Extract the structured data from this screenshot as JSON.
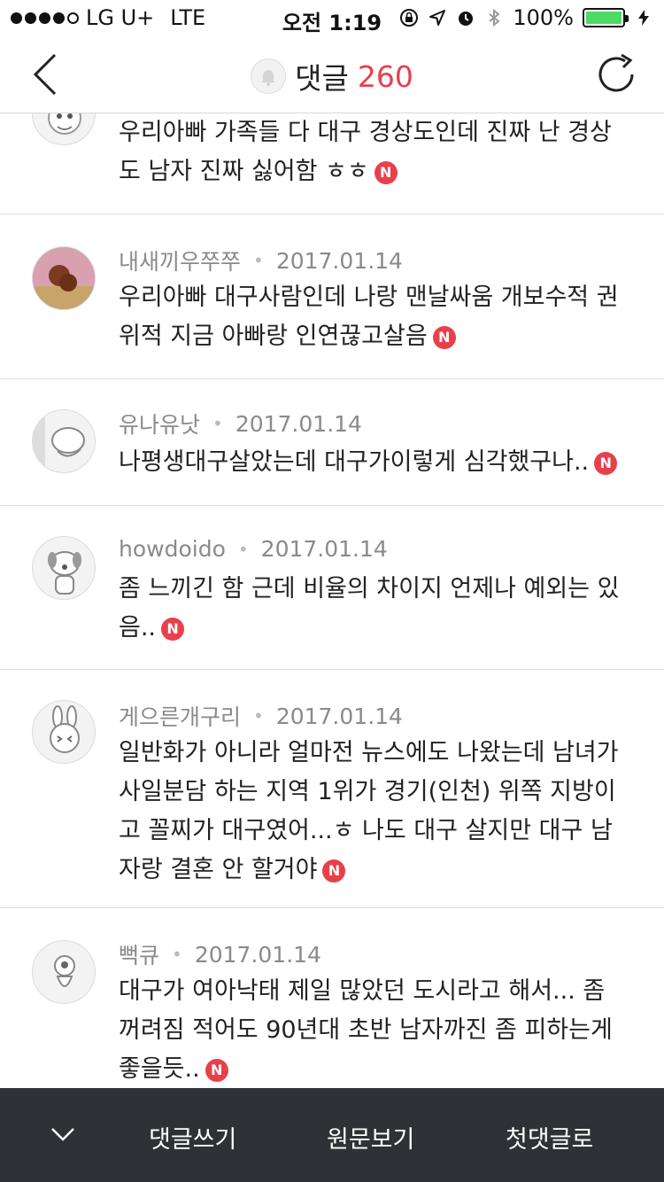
{
  "status_bar": {
    "carrier": "LG U+",
    "network": "LTE",
    "time": "오전 1:19",
    "battery": "100%",
    "signal_dots_filled": 4
  },
  "nav": {
    "title": "댓글",
    "count": "260"
  },
  "comments": [
    {
      "author": "",
      "date": "",
      "text": "우리아빠 가족들 다 대구 경상도인데 진짜 난 경상도 남자 진짜 싫어함 ㅎㅎ",
      "badge": "N",
      "avatar": "cartoon-character-icon"
    },
    {
      "author": "내새끼우쭈쭈",
      "date": "2017.01.14",
      "text": "우리아빠 대구사람인데 나랑 맨날싸움 개보수적 권위적 지금 아빠랑 인연끊고살음",
      "badge": "N",
      "avatar": "dog-photo-avatar"
    },
    {
      "author": "유나유낫",
      "date": "2017.01.14",
      "text": "나평생대구살았는데 대구가이렇게 심각했구나..",
      "badge": "N",
      "avatar": "cartoon-face-avatar"
    },
    {
      "author": "howdoido",
      "date": "2017.01.14",
      "text": "좀 느끼긴 함 근데 비율의 차이지 언제나 예외는 있음..",
      "badge": "N",
      "avatar": "cartoon-dog-avatar"
    },
    {
      "author": "게으른개구리",
      "date": "2017.01.14",
      "text": "일반화가 아니라 얼마전 뉴스에도 나왔는데 남녀가사일분담 하는 지역 1위가 경기(인천) 위쪽 지방이고 꼴찌가 대구였어...ㅎ 나도 대구 살지만 대구 남자랑 결혼 안 할거야",
      "badge": "N",
      "avatar": "cartoon-rabbit-avatar"
    },
    {
      "author": "뻑큐",
      "date": "2017.01.14",
      "text": "대구가 여아낙태 제일 많았던 도시라고 해서... 좀 꺼려짐 적어도 90년대 초반 남자까진 좀 피하는게 좋을듯..",
      "badge": "N",
      "avatar": "cartoon-alien-avatar"
    }
  ],
  "bottom_bar": {
    "write": "댓글쓰기",
    "original": "원문보기",
    "first": "첫댓글로"
  }
}
